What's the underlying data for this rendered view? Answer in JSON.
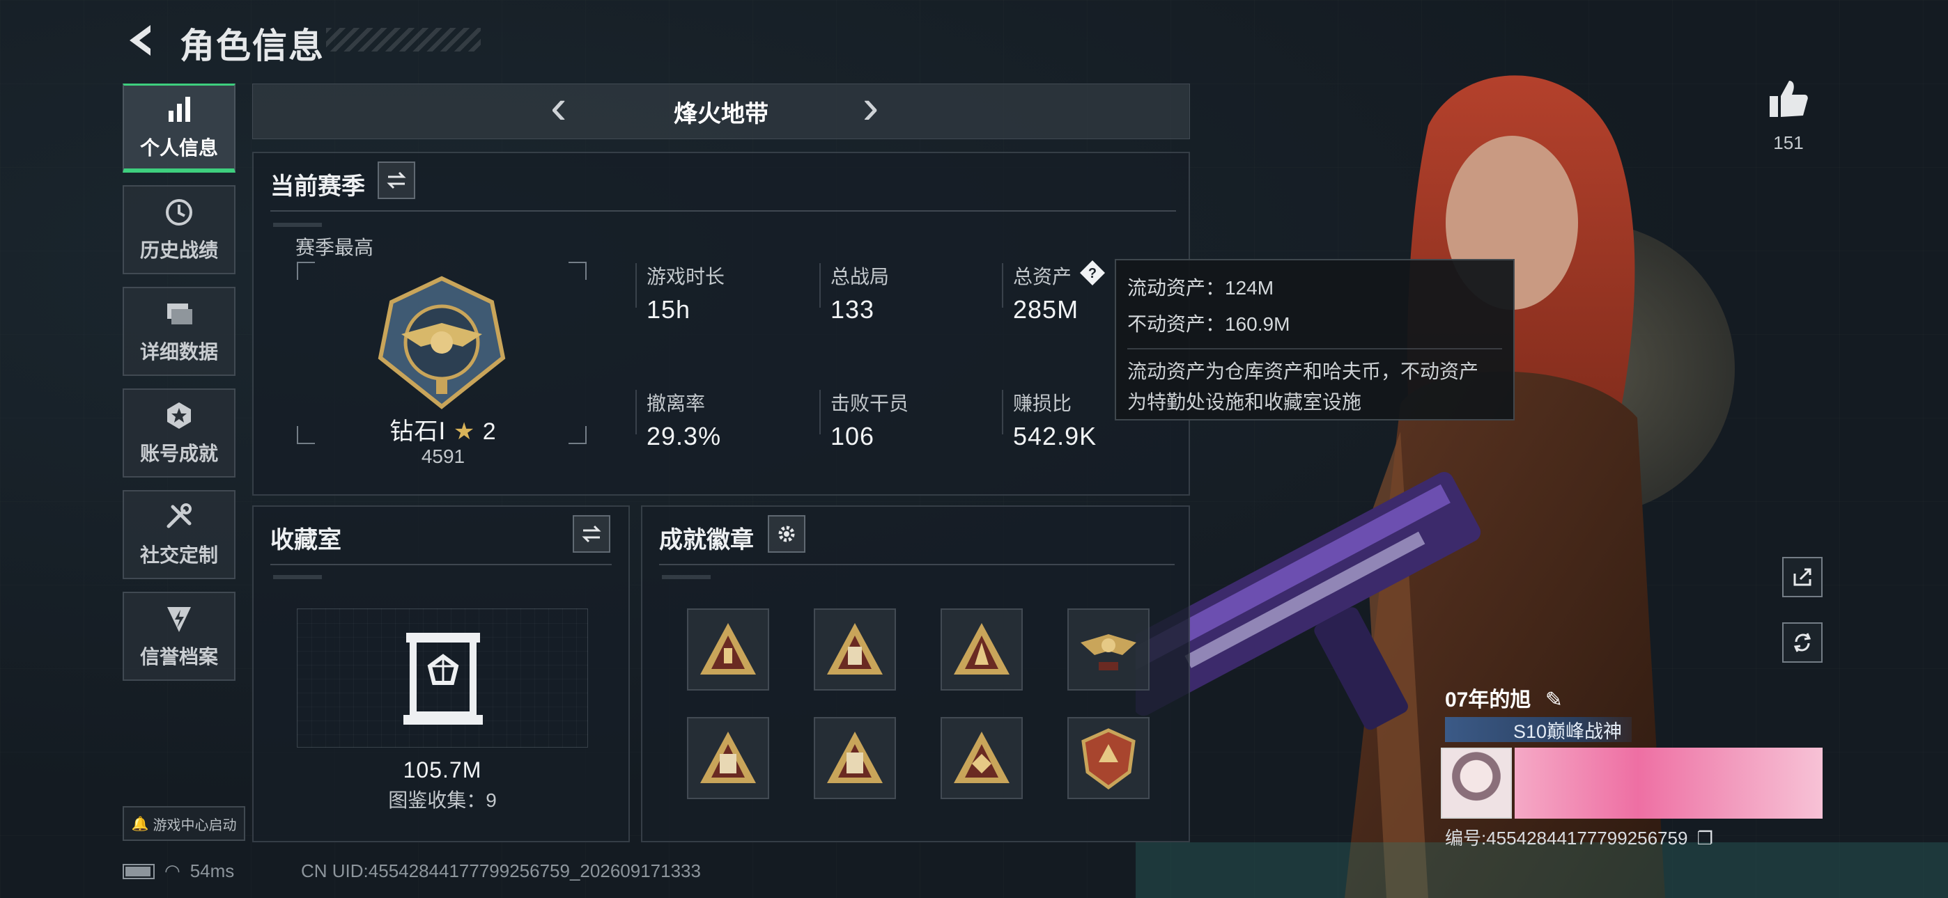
{
  "header": {
    "title": "角色信息",
    "back_icon": "back-arrow-icon"
  },
  "sidebar": {
    "items": [
      {
        "label": "个人信息",
        "icon": "bar-chart-icon",
        "active": true
      },
      {
        "label": "历史战绩",
        "icon": "history-clock-icon",
        "active": false
      },
      {
        "label": "详细数据",
        "icon": "folder-stack-icon",
        "active": false
      },
      {
        "label": "账号成就",
        "icon": "achievement-medal-icon",
        "active": false
      },
      {
        "label": "社交定制",
        "icon": "wrench-tools-icon",
        "active": false
      },
      {
        "label": "信誉档案",
        "icon": "shield-lightning-icon",
        "active": false
      }
    ],
    "game_center": "游戏中心启动"
  },
  "mode_tab": {
    "label": "烽火地带"
  },
  "season": {
    "title": "当前赛季",
    "best_label": "赛季最高",
    "rank_name": "钻石Ⅰ",
    "rank_stars": "2",
    "rank_points": "4591",
    "stats": [
      {
        "label": "游戏时长",
        "value": "15h"
      },
      {
        "label": "总战局",
        "value": "133"
      },
      {
        "label": "总资产",
        "value": "285M"
      },
      {
        "label": "撤离率",
        "value": "29.3%"
      },
      {
        "label": "击败干员",
        "value": "106"
      },
      {
        "label": "赚损比",
        "value": "542.9K"
      }
    ]
  },
  "tooltip": {
    "liquid": "流动资产：124M",
    "fixed": "不动资产：160.9M",
    "desc_line1": "流动资产为仓库资产和哈夫币，不动资产",
    "desc_line2": "为特勤处设施和收藏室设施"
  },
  "collection": {
    "title": "收藏室",
    "value": "105.7M",
    "count_text": "图鉴收集：9"
  },
  "badges": {
    "title": "成就徽章",
    "items": [
      "pyramid-badge-1",
      "pyramid-badge-2",
      "pyramid-badge-3",
      "eagle-badge",
      "pyramid-badge-5",
      "pyramid-badge-6",
      "pyramid-badge-7",
      "crest-badge"
    ]
  },
  "profile": {
    "like_count": "151",
    "name": "07年的旭",
    "title": "S10巅峰战神",
    "uid_line": "编号:4554284417779925675​9"
  },
  "status": {
    "ping": "54ms",
    "uid": "CN UID:4554284417779925675​9_202609171333"
  },
  "colors": {
    "accent": "#3ecf7e",
    "panel": "#161e26",
    "gold": "#c9a55a"
  }
}
